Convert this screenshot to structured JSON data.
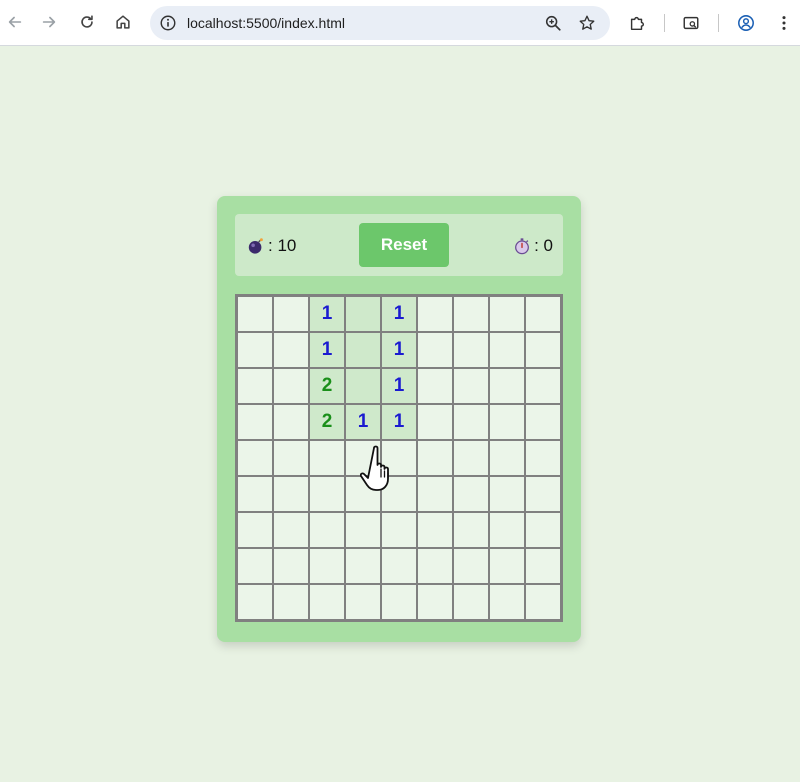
{
  "browser": {
    "url": "localhost:5500/index.html"
  },
  "game": {
    "mines_label": ": 10",
    "timer_label": ": 0",
    "reset_label": "Reset",
    "grid": [
      [
        "",
        "",
        "1",
        " ",
        "1",
        "",
        "",
        "",
        ""
      ],
      [
        "",
        "",
        "1",
        " ",
        "1",
        "",
        "",
        "",
        ""
      ],
      [
        "",
        "",
        "2",
        " ",
        "1",
        "",
        "",
        "",
        ""
      ],
      [
        "",
        "",
        "2",
        "1",
        "1",
        "",
        "",
        "",
        ""
      ],
      [
        "",
        "",
        "",
        "",
        "",
        "",
        "",
        "",
        ""
      ],
      [
        "",
        "",
        "",
        "",
        "",
        "",
        "",
        "",
        ""
      ],
      [
        "",
        "",
        "",
        "",
        "",
        "",
        "",
        "",
        ""
      ],
      [
        "",
        "",
        "",
        "",
        "",
        "",
        "",
        "",
        ""
      ],
      [
        "",
        "",
        "",
        "",
        "",
        "",
        "",
        "",
        ""
      ]
    ]
  },
  "colors": {
    "page_bg": "#e8f2e3",
    "panel_bg": "#a8dfa3",
    "header_bg": "#cde9c9",
    "reset_bg": "#6cc76b",
    "cell_hidden": "#ebf5e9",
    "cell_revealed": "#cfe9cb",
    "number_1": "#1b1bd0",
    "number_2": "#1a8f1a"
  }
}
